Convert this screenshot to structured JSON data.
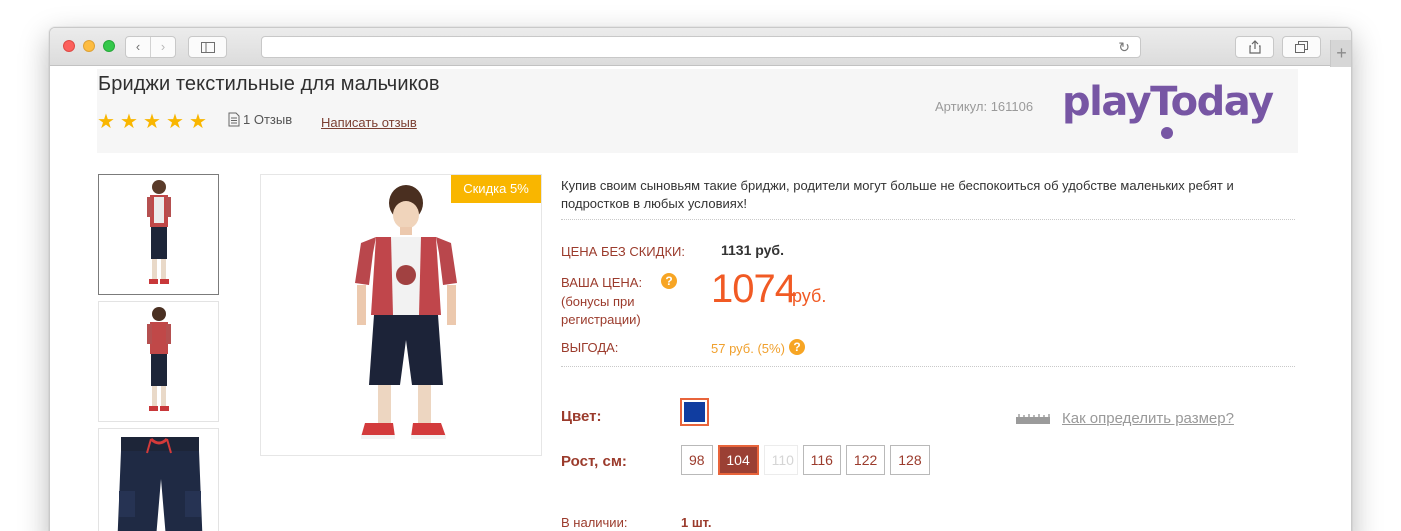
{
  "browser": {
    "nav_back": "‹",
    "nav_forward": "›",
    "reload": "↻",
    "new_tab": "+"
  },
  "product": {
    "title": "Бриджи текстильные для мальчиков",
    "rating": 5,
    "reviews": "1 Отзыв",
    "write_review": "Написать отзыв",
    "article": "Артикул: 161106",
    "discount": "Скидка 5%",
    "description": "Купив своим сыновьям такие бриджи, родители могут больше не беспокоиться об удобстве маленьких ребят и подростков в любых условиях!"
  },
  "logo": {
    "text": "playToday",
    "color": "#7756a4"
  },
  "pricing": {
    "no_discount_label": "ЦЕНА БЕЗ СКИДКИ:",
    "no_discount_value": "1131 руб.",
    "your_price_label": "ВАША ЦЕНА:",
    "bonus_label_line1": "(бонусы при",
    "bonus_label_line2": "регистрации)",
    "your_price_value": "1074",
    "your_price_unit": "руб.",
    "savings_label": "ВЫГОДА:",
    "savings_value": "57 руб. (5%)"
  },
  "options": {
    "color_label": "Цвет:",
    "color_value": "#103da0",
    "size_guide": "Как определить размер?",
    "height_label": "Рост, см:",
    "sizes": [
      {
        "label": "98",
        "state": "available"
      },
      {
        "label": "104",
        "state": "selected"
      },
      {
        "label": "110",
        "state": "disabled"
      },
      {
        "label": "116",
        "state": "available"
      },
      {
        "label": "122",
        "state": "available"
      },
      {
        "label": "128",
        "state": "available"
      }
    ]
  },
  "stock": {
    "label": "В наличии:",
    "value": "1 шт."
  },
  "colors": {
    "accent": "#f15a24",
    "label_red": "#9b3b2c",
    "star": "#f9b600"
  }
}
